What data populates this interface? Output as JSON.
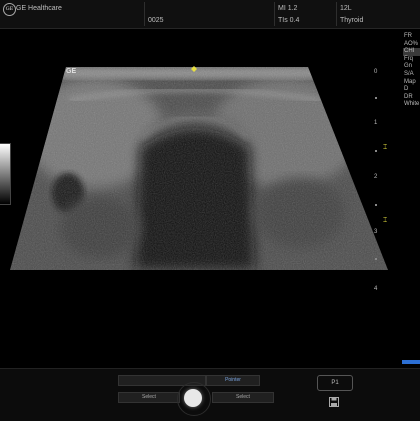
{
  "header": {
    "brand": "GE Healthcare",
    "exam_id": "0025",
    "mi": "MI 1.2",
    "tis": "TIs 0.4",
    "probe": "12L",
    "preset": "Thyroid"
  },
  "image": {
    "overlay_logo": "GE"
  },
  "depth_scale": [
    "0",
    "1",
    "2",
    "3",
    "4"
  ],
  "params": [
    "FR",
    "AO%",
    "CHI",
    "Frq",
    "Gn",
    "S/A",
    "Map",
    "D",
    "DR",
    "White"
  ],
  "controls": {
    "top_label": "Pointer",
    "left_select": "Select",
    "right_select": "Select",
    "preset_button": "P1"
  },
  "icons": {
    "brand": "ge-logo-icon",
    "save": "save-icon",
    "focus": "focus-marker-icon"
  },
  "colors": {
    "focus": "#e8e040",
    "accent": "#2c6fd4"
  }
}
